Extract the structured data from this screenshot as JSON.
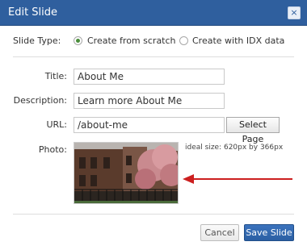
{
  "dialog": {
    "title": "Edit Slide",
    "close_glyph": "×"
  },
  "slide_type": {
    "label": "Slide Type:",
    "options": [
      {
        "label": "Create from scratch",
        "checked": true
      },
      {
        "label": "Create with IDX data",
        "checked": false
      }
    ]
  },
  "fields": {
    "title_label": "Title:",
    "title_value": "About Me",
    "description_label": "Description:",
    "description_value": "Learn more About Me",
    "url_label": "URL:",
    "url_value": "/about-me",
    "select_page_label": "Select Page",
    "photo_label": "Photo:",
    "photo_hint": "ideal size: 620px by 366px"
  },
  "footer": {
    "cancel_label": "Cancel",
    "save_label": "Save Slide"
  },
  "colors": {
    "titlebar": "#2f5f9e",
    "save_button": "#2b5fa3",
    "arrow": "#cc1f1f",
    "radio_checked": "#4a8d3a"
  },
  "icons": {
    "close": "close-icon",
    "annotation_arrow": "arrow-left-icon"
  }
}
